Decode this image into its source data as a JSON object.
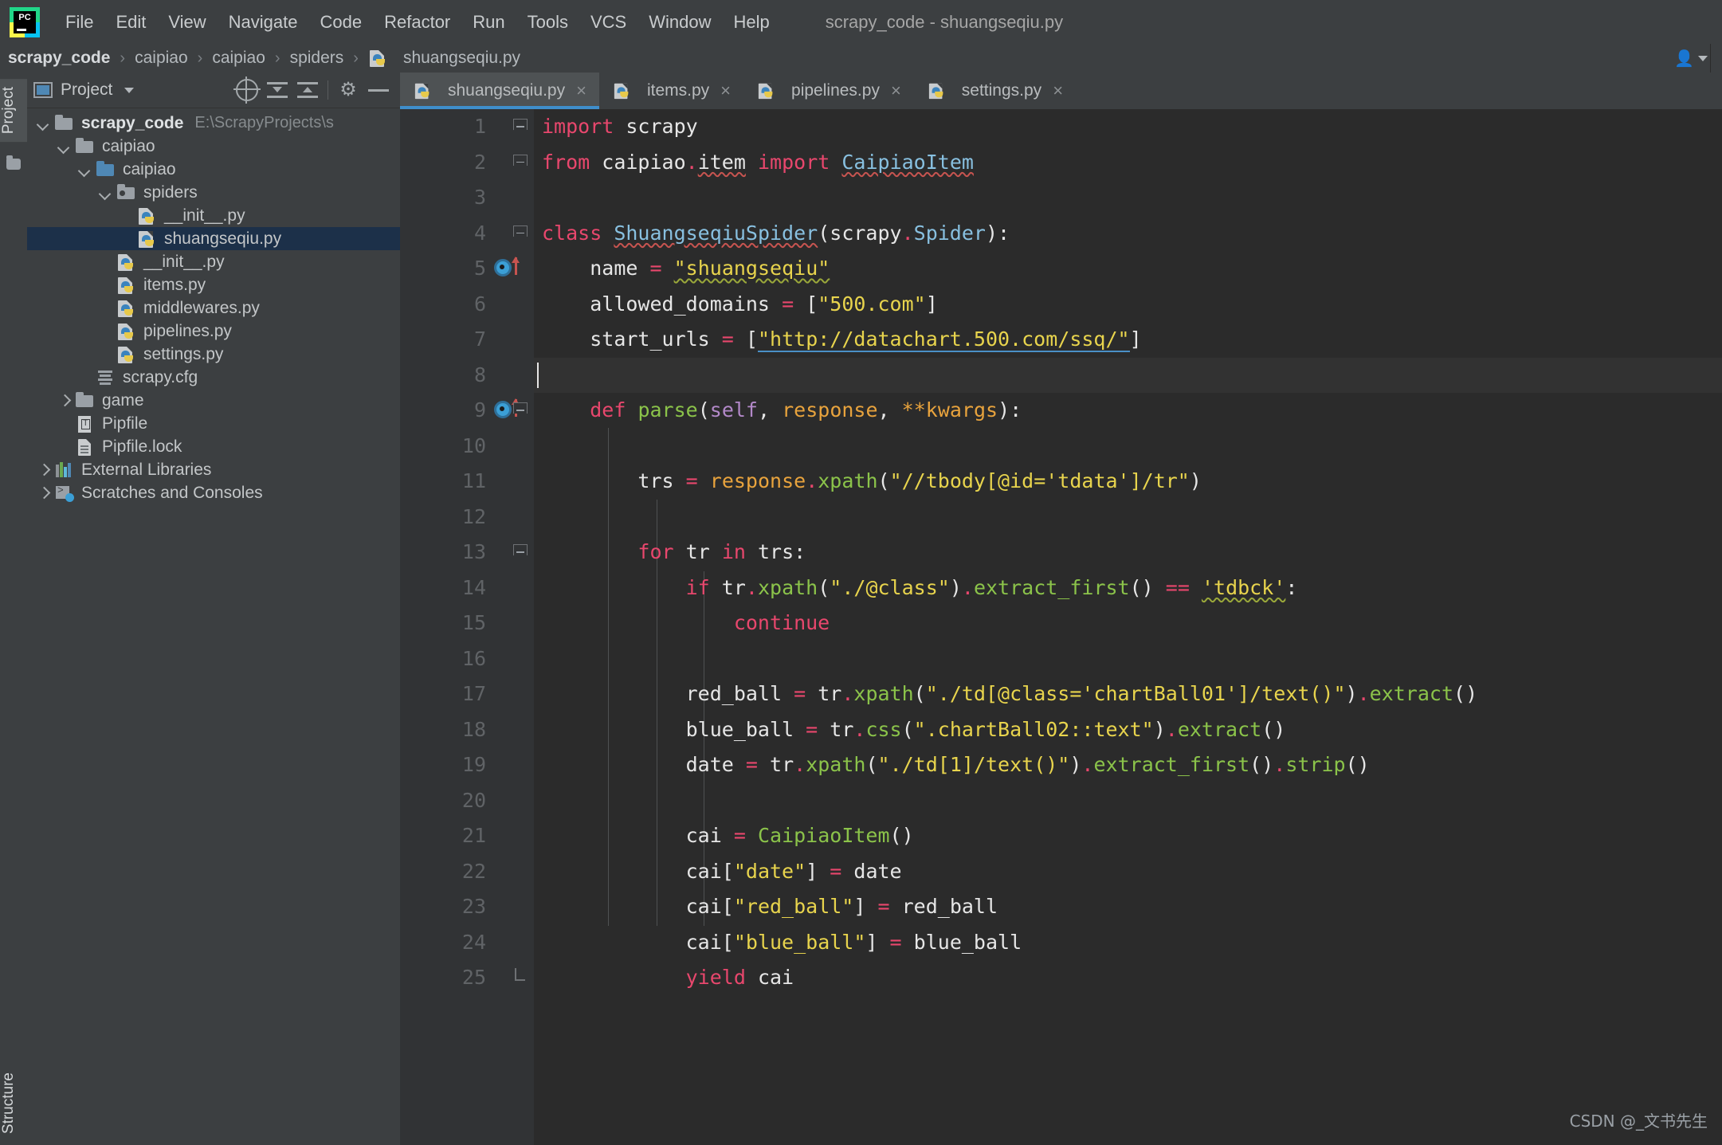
{
  "window": {
    "title": "scrapy_code - shuangseqiu.py",
    "logo_text": "PC"
  },
  "menubar": {
    "items": [
      {
        "label": "File"
      },
      {
        "label": "Edit"
      },
      {
        "label": "View"
      },
      {
        "label": "Navigate"
      },
      {
        "label": "Code"
      },
      {
        "label": "Refactor"
      },
      {
        "label": "Run"
      },
      {
        "label": "Tools"
      },
      {
        "label": "VCS"
      },
      {
        "label": "Window"
      },
      {
        "label": "Help"
      }
    ]
  },
  "breadcrumb": {
    "items": [
      "scrapy_code",
      "caipiao",
      "caipiao",
      "spiders",
      "shuangseqiu.py"
    ],
    "separator": "›"
  },
  "left_strips": {
    "project_tab": "Project",
    "structure_tab": "Structure"
  },
  "toolwindow": {
    "title": "Project",
    "icons": [
      "window-icon",
      "chevron-down-icon",
      "locate-icon",
      "expand-all-icon",
      "collapse-all-icon",
      "gear-icon",
      "hide-icon"
    ]
  },
  "tree": {
    "items": [
      {
        "label": "scrapy_code",
        "path": "E:\\ScrapyProjects\\s",
        "indent": 0,
        "twisty": "down",
        "icon": "folder",
        "bold": true,
        "selected": false
      },
      {
        "label": "caipiao",
        "path": "",
        "indent": 1,
        "twisty": "down",
        "icon": "folder",
        "bold": false,
        "selected": false
      },
      {
        "label": "caipiao",
        "path": "",
        "indent": 2,
        "twisty": "down",
        "icon": "folder-blue",
        "bold": false,
        "selected": false
      },
      {
        "label": "spiders",
        "path": "",
        "indent": 3,
        "twisty": "down",
        "icon": "folder-src",
        "bold": false,
        "selected": false
      },
      {
        "label": "__init__.py",
        "path": "",
        "indent": 4,
        "twisty": "none",
        "icon": "python",
        "bold": false,
        "selected": false
      },
      {
        "label": "shuangseqiu.py",
        "path": "",
        "indent": 4,
        "twisty": "none",
        "icon": "python",
        "bold": false,
        "selected": true
      },
      {
        "label": "__init__.py",
        "path": "",
        "indent": 3,
        "twisty": "none",
        "icon": "python",
        "bold": false,
        "selected": false
      },
      {
        "label": "items.py",
        "path": "",
        "indent": 3,
        "twisty": "none",
        "icon": "python",
        "bold": false,
        "selected": false
      },
      {
        "label": "middlewares.py",
        "path": "",
        "indent": 3,
        "twisty": "none",
        "icon": "python",
        "bold": false,
        "selected": false
      },
      {
        "label": "pipelines.py",
        "path": "",
        "indent": 3,
        "twisty": "none",
        "icon": "python",
        "bold": false,
        "selected": false
      },
      {
        "label": "settings.py",
        "path": "",
        "indent": 3,
        "twisty": "none",
        "icon": "python",
        "bold": false,
        "selected": false
      },
      {
        "label": "scrapy.cfg",
        "path": "",
        "indent": 2,
        "twisty": "none",
        "icon": "cfg",
        "bold": false,
        "selected": false
      },
      {
        "label": "game",
        "path": "",
        "indent": 1,
        "twisty": "right",
        "icon": "folder",
        "bold": false,
        "selected": false
      },
      {
        "label": "Pipfile",
        "path": "",
        "indent": 1,
        "twisty": "none",
        "icon": "pipfile",
        "bold": false,
        "selected": false
      },
      {
        "label": "Pipfile.lock",
        "path": "",
        "indent": 1,
        "twisty": "none",
        "icon": "doc",
        "bold": false,
        "selected": false
      },
      {
        "label": "External Libraries",
        "path": "",
        "indent": 0,
        "twisty": "right",
        "icon": "library",
        "bold": false,
        "selected": false
      },
      {
        "label": "Scratches and Consoles",
        "path": "",
        "indent": 0,
        "twisty": "right",
        "icon": "scratches",
        "bold": false,
        "selected": false
      }
    ]
  },
  "editor_tabs": [
    {
      "label": "shuangseqiu.py",
      "active": true,
      "close": "×"
    },
    {
      "label": "items.py",
      "active": false,
      "close": "×"
    },
    {
      "label": "pipelines.py",
      "active": false,
      "close": "×"
    },
    {
      "label": "settings.py",
      "active": false,
      "close": "×"
    }
  ],
  "code": {
    "language": "python",
    "caret_line": 8,
    "lines": [
      {
        "n": 1,
        "marks": [
          "fold-top"
        ],
        "text": "import scrapy"
      },
      {
        "n": 2,
        "marks": [
          "fold-top"
        ],
        "text": "from caipiao.item import CaipiaoItem"
      },
      {
        "n": 3,
        "marks": [],
        "text": ""
      },
      {
        "n": 4,
        "marks": [
          "fold-top"
        ],
        "text": "class ShuangseqiuSpider(scrapy.Spider):"
      },
      {
        "n": 5,
        "marks": [
          "run",
          "up-arrow"
        ],
        "text": "    name = \"shuangseqiu\""
      },
      {
        "n": 6,
        "marks": [],
        "text": "    allowed_domains = [\"500.com\"]"
      },
      {
        "n": 7,
        "marks": [],
        "text": "    start_urls = [\"http://datachart.500.com/ssq/\"]"
      },
      {
        "n": 8,
        "marks": [],
        "text": ""
      },
      {
        "n": 9,
        "marks": [
          "run",
          "up-arrow",
          "fold-top"
        ],
        "text": "    def parse(self, response, **kwargs):"
      },
      {
        "n": 10,
        "marks": [],
        "text": ""
      },
      {
        "n": 11,
        "marks": [],
        "text": "        trs = response.xpath(\"//tbody[@id='tdata']/tr\")"
      },
      {
        "n": 12,
        "marks": [],
        "text": ""
      },
      {
        "n": 13,
        "marks": [
          "fold-top"
        ],
        "text": "        for tr in trs:"
      },
      {
        "n": 14,
        "marks": [],
        "text": "            if tr.xpath(\"./@class\").extract_first() == 'tdbck':"
      },
      {
        "n": 15,
        "marks": [],
        "text": "                continue"
      },
      {
        "n": 16,
        "marks": [],
        "text": ""
      },
      {
        "n": 17,
        "marks": [],
        "text": "            red_ball = tr.xpath(\"./td[@class='chartBall01']/text()\").extract()"
      },
      {
        "n": 18,
        "marks": [],
        "text": "            blue_ball = tr.css(\".chartBall02::text\").extract()"
      },
      {
        "n": 19,
        "marks": [],
        "text": "            date = tr.xpath(\"./td[1]/text()\").extract_first().strip()"
      },
      {
        "n": 20,
        "marks": [],
        "text": ""
      },
      {
        "n": 21,
        "marks": [],
        "text": "            cai = CaipiaoItem()"
      },
      {
        "n": 22,
        "marks": [],
        "text": "            cai[\"date\"] = date"
      },
      {
        "n": 23,
        "marks": [],
        "text": "            cai[\"red_ball\"] = red_ball"
      },
      {
        "n": 24,
        "marks": [],
        "text": "            cai[\"blue_ball\"] = blue_ball"
      },
      {
        "n": 25,
        "marks": [
          "fold-end"
        ],
        "text": "            yield cai"
      }
    ]
  },
  "watermark": "CSDN @_文书先生",
  "colors": {
    "background": "#2b2b2b",
    "chrome": "#3c3f41",
    "gutter": "#313335",
    "selection": "#1c3049",
    "accent": "#3f8ecb",
    "keyword": "#e8476d",
    "string": "#e8d44d",
    "class_name": "#88c0e0",
    "function": "#8bc34a",
    "parameter": "#e8a33d",
    "self": "#b389c9",
    "text": "#e6e6e6"
  }
}
